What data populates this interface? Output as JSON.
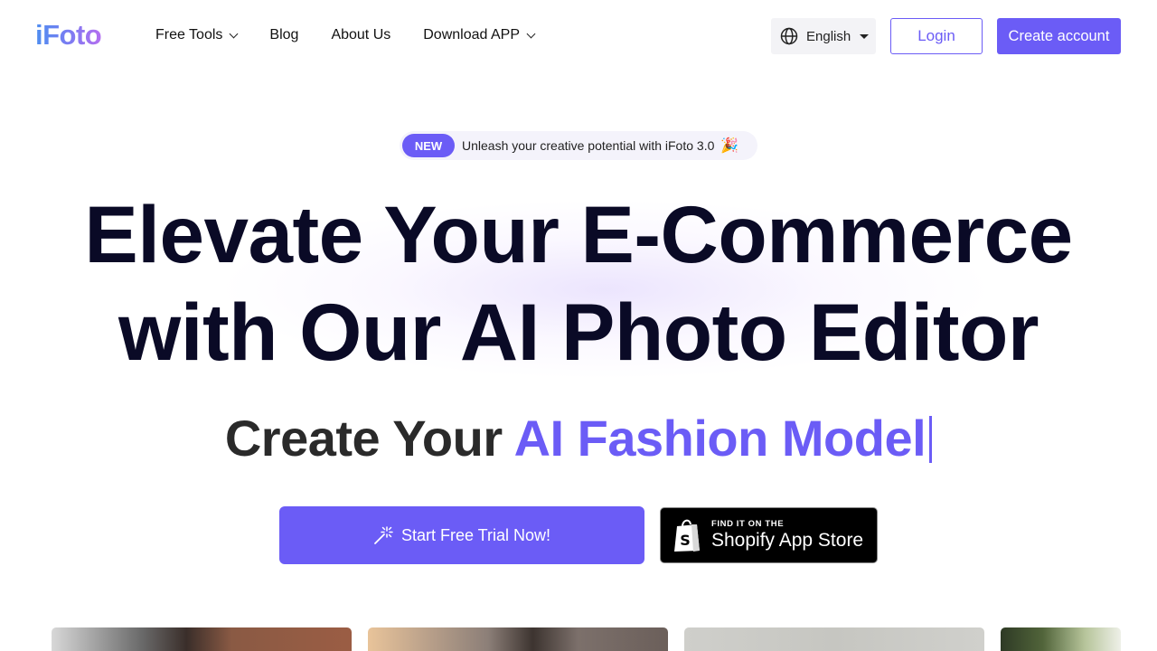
{
  "header": {
    "logo": "iFoto",
    "nav": [
      {
        "label": "Free Tools",
        "has_dropdown": true
      },
      {
        "label": "Blog",
        "has_dropdown": false
      },
      {
        "label": "About Us",
        "has_dropdown": false
      },
      {
        "label": "Download APP",
        "has_dropdown": true
      }
    ],
    "language": {
      "icon": "globe-icon",
      "selected": "English"
    },
    "login_label": "Login",
    "create_account_label": "Create account"
  },
  "hero": {
    "badge": {
      "tag": "NEW",
      "message": "Unleash your creative potential with iFoto 3.0",
      "emoji": "🎉"
    },
    "headline_line1": "Elevate Your E-Commerce",
    "headline_line2": "with Our AI Photo Editor",
    "subline_prefix": "Create Your",
    "subline_accent": "AI Fashion Model",
    "cta_primary": {
      "icon": "magic-wand-icon",
      "label": "Start Free Trial Now!"
    },
    "cta_shopify": {
      "icon": "shopify-bag-icon",
      "small": "FIND IT ON THE",
      "big": "Shopify App Store"
    }
  },
  "colors": {
    "accent": "#6b5cf6",
    "heading": "#0a0a26",
    "badge_bg": "#f4f3fb",
    "lang_bg": "#f3f3f6"
  },
  "gallery": {
    "cards": [
      {
        "name": "street-model-photo"
      },
      {
        "name": "studio-model-photo"
      },
      {
        "name": "grey-background-photo"
      },
      {
        "name": "outdoor-greenery-photo"
      }
    ]
  }
}
